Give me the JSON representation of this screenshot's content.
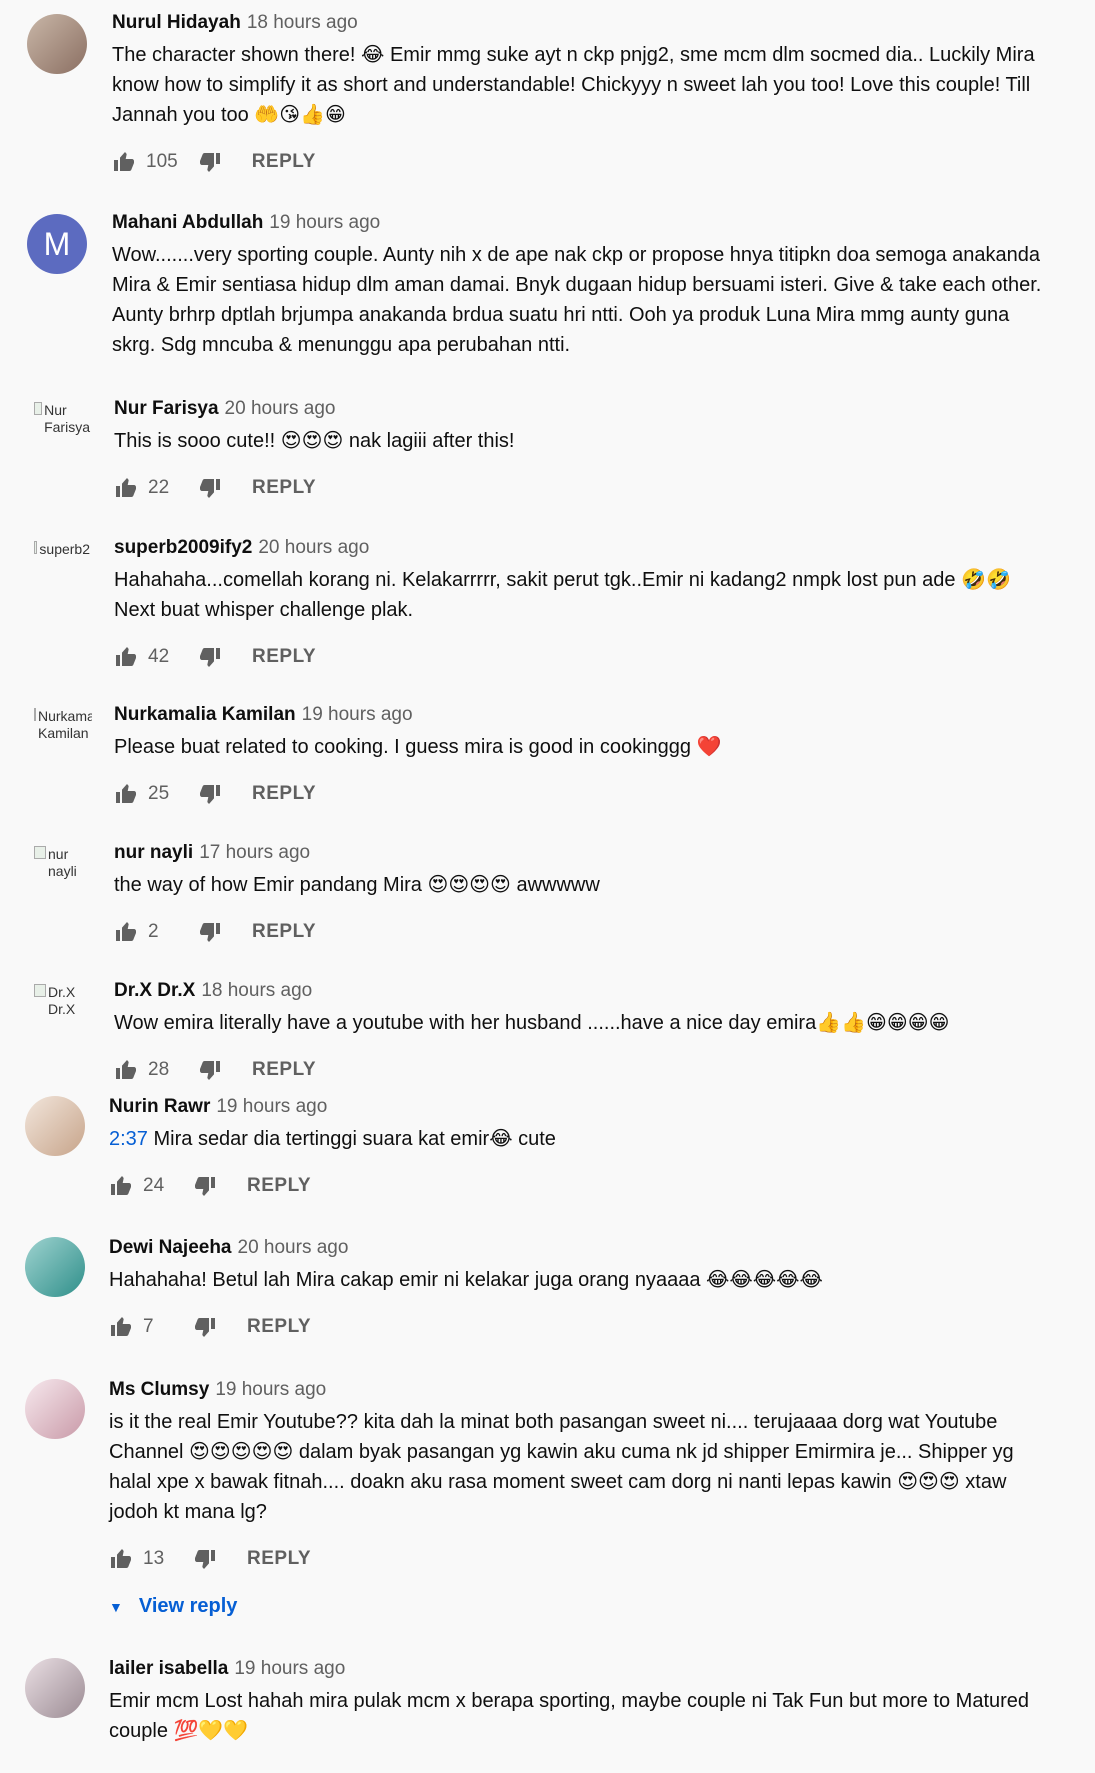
{
  "actions": {
    "reply_label": "REPLY",
    "view_reply_label": "View reply"
  },
  "icons": {
    "like": "thumb-up-outline-icon",
    "dislike": "thumb-down-outline-icon",
    "expand": "chevron-down-icon"
  },
  "colors": {
    "link": "#065fd4",
    "secondary_text": "#606060",
    "avatar_letter_bg": "#5c6bc0"
  },
  "comments": [
    {
      "author": "Nurul Hidayah",
      "time": "18 hours ago",
      "text": "The character shown there! 😂 Emir mmg suke ayt n ckp pnjg2, sme mcm dlm socmed dia.. Luckily Mira know how to simplify it as short and understandable! Chickyyy n sweet lah you too! Love this couple! Till Jannah you too 🤲😘👍😁",
      "likes": "105",
      "avatar_type": "photo"
    },
    {
      "author": "Mahani Abdullah",
      "time": "19 hours ago",
      "text": "Wow.......very sporting couple. Aunty nih x de ape nak ckp or propose hnya titipkn doa semoga anakanda Mira & Emir  sentiasa hidup dlm aman damai. Bnyk dugaan hidup bersuami isteri. Give & take each other. Aunty brhrp dptlah brjumpa anakanda brdua suatu hri ntti. Ooh ya produk Luna Mira mmg aunty guna skrg. Sdg mncuba & menunggu apa perubahan ntti.",
      "likes": "",
      "avatar_type": "letter",
      "avatar_letter": "M"
    },
    {
      "author": "Nur Farisya",
      "time": "20 hours ago",
      "text": "This is sooo cute!! 😍😍😍 nak lagiii after this!",
      "likes": "22",
      "avatar_type": "broken",
      "avatar_alt": "Nur\nFarisya"
    },
    {
      "author": "superb2009ify2",
      "time": "20 hours ago",
      "text": "Hahahaha...comellah korang ni. Kelakarrrrr, sakit perut tgk..Emir ni kadang2 nmpk lost pun ade 🤣🤣 Next buat whisper challenge plak.",
      "likes": "42",
      "avatar_type": "broken",
      "avatar_alt": "superb2"
    },
    {
      "author": "Nurkamalia Kamilan",
      "time": "19 hours ago",
      "text": "Please buat related to cooking. I guess mira is good in cookinggg ❤️",
      "likes": "25",
      "avatar_type": "broken",
      "avatar_alt": "Nurkamalia\nKamilan"
    },
    {
      "author": "nur nayli",
      "time": "17 hours ago",
      "text": "the way of how Emir pandang Mira 😍😍😍😍 awwwww",
      "likes": "2",
      "avatar_type": "broken",
      "avatar_alt": "nur\nnayli"
    },
    {
      "author": "Dr.X Dr.X",
      "time": "18 hours ago",
      "text": "Wow emira literally have a youtube with her husband ......have a nice day emira👍👍😁😁😁😁",
      "likes": "28",
      "avatar_type": "broken",
      "avatar_alt": "Dr.X\nDr.X"
    },
    {
      "author": "Nurin Rawr",
      "time": "19 hours ago",
      "timestamp_link": "2:37",
      "text": " Mira sedar dia tertinggi suara kat emir😂 cute",
      "likes": "24",
      "avatar_type": "photo"
    },
    {
      "author": "Dewi Najeeha",
      "time": "20 hours ago",
      "text": "Hahahaha! Betul lah Mira cakap emir ni kelakar juga orang nyaaaa 😂😂😂😂😂",
      "likes": "7",
      "avatar_type": "photo"
    },
    {
      "author": "Ms Clumsy",
      "time": "19 hours ago",
      "text": "is it the real Emir Youtube?? kita dah la minat both pasangan sweet ni.... terujaaaa dorg wat Youtube Channel 😍😍😍😍😍 dalam byak pasangan yg kawin aku cuma nk jd shipper Emirmira je... Shipper yg halal xpe x bawak fitnah.... doakn aku rasa moment sweet cam dorg ni nanti lepas kawin 😍😍😍 xtaw jodoh kt mana lg?",
      "likes": "13",
      "avatar_type": "photo",
      "has_replies": true
    },
    {
      "author": "lailer isabella",
      "time": "19 hours ago",
      "text": "Emir mcm Lost hahah mira pulak mcm x berapa sporting, maybe couple ni Tak Fun but more to Matured couple 💯💛💛",
      "likes": "",
      "avatar_type": "photo"
    }
  ]
}
